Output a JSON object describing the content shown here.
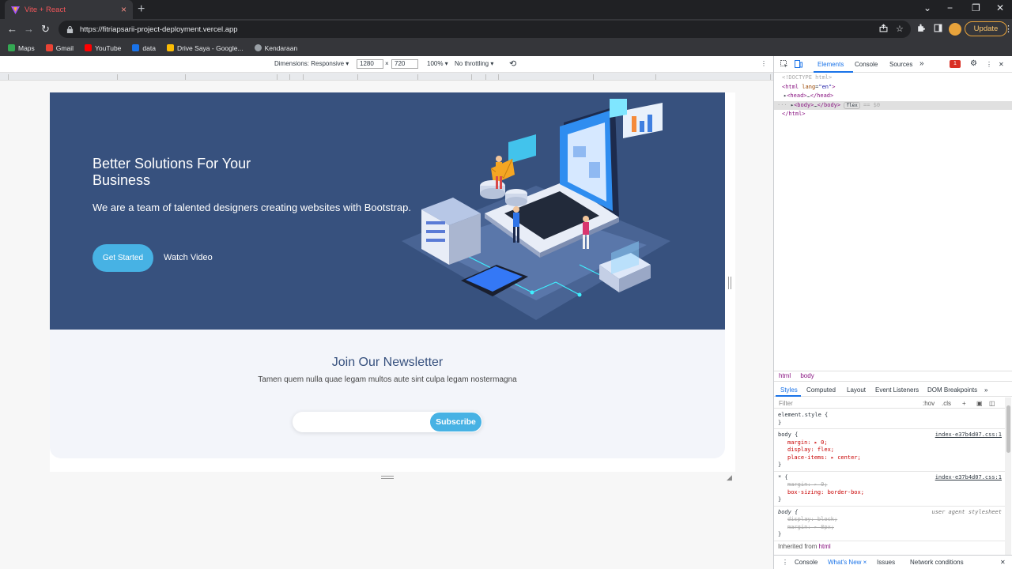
{
  "tab": {
    "title": "Vite + React",
    "close": "×"
  },
  "new_tab": "+",
  "window_controls": {
    "dropdown": "⌄",
    "minimize": "−",
    "restore": "❐",
    "close": "✕"
  },
  "nav": {
    "back": "←",
    "forward": "→",
    "reload": "↻"
  },
  "address": {
    "url": "https://fitriapsarii-project-deployment.vercel.app"
  },
  "update_label": "Update",
  "bookmarks": [
    {
      "label": "Maps",
      "color": "#34a853"
    },
    {
      "label": "Gmail",
      "color": "#ea4335"
    },
    {
      "label": "YouTube",
      "color": "#ff0000"
    },
    {
      "label": "data",
      "color": "#1a73e8"
    },
    {
      "label": "Drive Saya - Google...",
      "color": "#fbbc04"
    },
    {
      "label": "Kendaraan",
      "color": "#9aa0a6"
    }
  ],
  "device_toolbar": {
    "dimensions": "Dimensions: Responsive ▾",
    "width": "1280",
    "times": "×",
    "height": "720",
    "zoom": "100% ▾",
    "throttling": "No throttling ▾",
    "rotate": "⟲",
    "more": "⋮"
  },
  "hero": {
    "title": "Better Solutions For Your Business",
    "subtitle": "We are a team of talented designers creating websites with Bootstrap.",
    "cta": "Get Started",
    "video": "Watch Video"
  },
  "newsletter": {
    "title": "Join Our Newsletter",
    "subtitle": "Tamen quem nulla quae legam multos aute sint culpa legam nostermagna",
    "button": "Subscribe"
  },
  "devtools": {
    "tabs": [
      "Elements",
      "Console",
      "Sources",
      "»"
    ],
    "error_count": "1",
    "dom": {
      "doctype": "<!DOCTYPE html>",
      "html_open_a": "<html ",
      "lang_attr": "lang",
      "lang_val": "\"en\"",
      "html_open_b": ">",
      "head": "<head>",
      "head_ellipsis": "…",
      "head_close": "</head>",
      "body": "<body>",
      "body_ellipsis": "…",
      "body_close": "</body>",
      "flex_badge": "flex",
      "eq": "== $0",
      "html_close": "</html>"
    },
    "breadcrumbs": [
      "html",
      "body"
    ],
    "styles_tabs": [
      "Styles",
      "Computed",
      "Layout",
      "Event Listeners",
      "DOM Breakpoints",
      "»"
    ],
    "filter_placeholder": "Filter",
    "filter_hov": ":hov",
    "filter_cls": ".cls",
    "filter_plus": "+",
    "rules": {
      "element_style_open": "element.style {",
      "close": "}",
      "body_sel": "body {",
      "body_src": "index-e37b4d07.css:1",
      "body_margin": "margin: ▸ 0;",
      "body_display": "display: flex;",
      "body_place": "place-items: ▸ center;",
      "star_sel": "* {",
      "star_src": "index-e37b4d07.css:1",
      "star_margin": "margin: ▸ 0;",
      "star_box": "box-sizing: border-box;",
      "ua_sel": "body {",
      "ua_src": "user agent stylesheet",
      "ua_display": "display: block;",
      "ua_margin": "margin: ▸ 8px;"
    },
    "inherited_label": "Inherited from ",
    "inherited_tag": "html",
    "drawer_tabs": [
      "⋮",
      "Console",
      "What's New ×",
      "Issues",
      "Network conditions"
    ],
    "drawer_close": "✕"
  }
}
